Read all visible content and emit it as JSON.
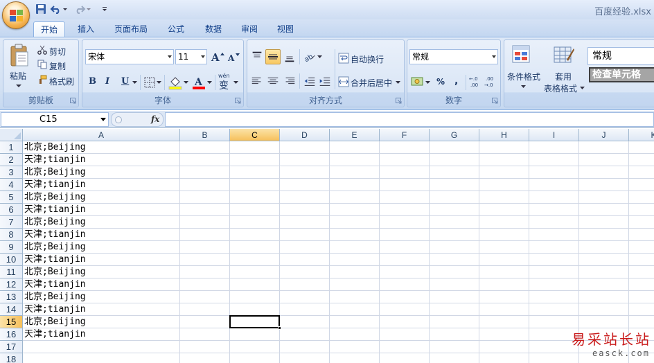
{
  "window": {
    "title": "百度经验.xlsx"
  },
  "tabs": [
    {
      "label": "开始",
      "active": true
    },
    {
      "label": "插入"
    },
    {
      "label": "页面布局"
    },
    {
      "label": "公式"
    },
    {
      "label": "数据"
    },
    {
      "label": "审阅"
    },
    {
      "label": "视图"
    }
  ],
  "clipboard": {
    "paste_label": "粘贴",
    "cut_label": "剪切",
    "copy_label": "复制",
    "format_painter_label": "格式刷",
    "group_label": "剪贴板"
  },
  "font": {
    "font_name": "宋体",
    "font_size": "11",
    "bold": "B",
    "italic": "I",
    "underline": "U",
    "phonetic": "wén",
    "group_label": "字体",
    "font_color": "#ff0000",
    "fill_color": "#ffff00"
  },
  "alignment": {
    "wrap_text_label": "自动换行",
    "merge_center_label": "合并后居中",
    "group_label": "对齐方式"
  },
  "number": {
    "format_value": "常规",
    "percent": "%",
    "comma": ",",
    "group_label": "数字"
  },
  "styles": {
    "conditional_format_label": "条件格式",
    "table_format_label_1": "套用",
    "table_format_label_2": "表格格式",
    "cell_style_normal": "常规",
    "cell_style_check": "检查单元格"
  },
  "formula_bar": {
    "name_box": "C15",
    "fx_label": "fx",
    "formula": ""
  },
  "sheet": {
    "columns": [
      "A",
      "B",
      "C",
      "D",
      "E",
      "F",
      "G",
      "H",
      "I",
      "J",
      "K"
    ],
    "selected_column": "C",
    "rows": [
      "1",
      "2",
      "3",
      "4",
      "5",
      "6",
      "7",
      "8",
      "9",
      "10",
      "11",
      "12",
      "13",
      "14",
      "15",
      "16",
      "17",
      "18"
    ],
    "selected_row": "15",
    "active_cell": "C15",
    "column_a_values": [
      "北京;Beijing",
      "天津;tianjin",
      "北京;Beijing",
      "天津;tianjin",
      "北京;Beijing",
      "天津;tianjin",
      "北京;Beijing",
      "天津;tianjin",
      "北京;Beijing",
      "天津;tianjin",
      "北京;Beijing",
      "天津;tianjin",
      "北京;Beijing",
      "天津;tianjin",
      "北京;Beijing",
      "天津;tianjin"
    ]
  },
  "watermark": {
    "name": "易采站长站",
    "url": "easck.com"
  },
  "colors": {
    "ribbon_bg": "#dae6f6",
    "accent_text": "#15428b",
    "selected_header": "#f6c05b",
    "gridline": "#d0d7e5"
  }
}
